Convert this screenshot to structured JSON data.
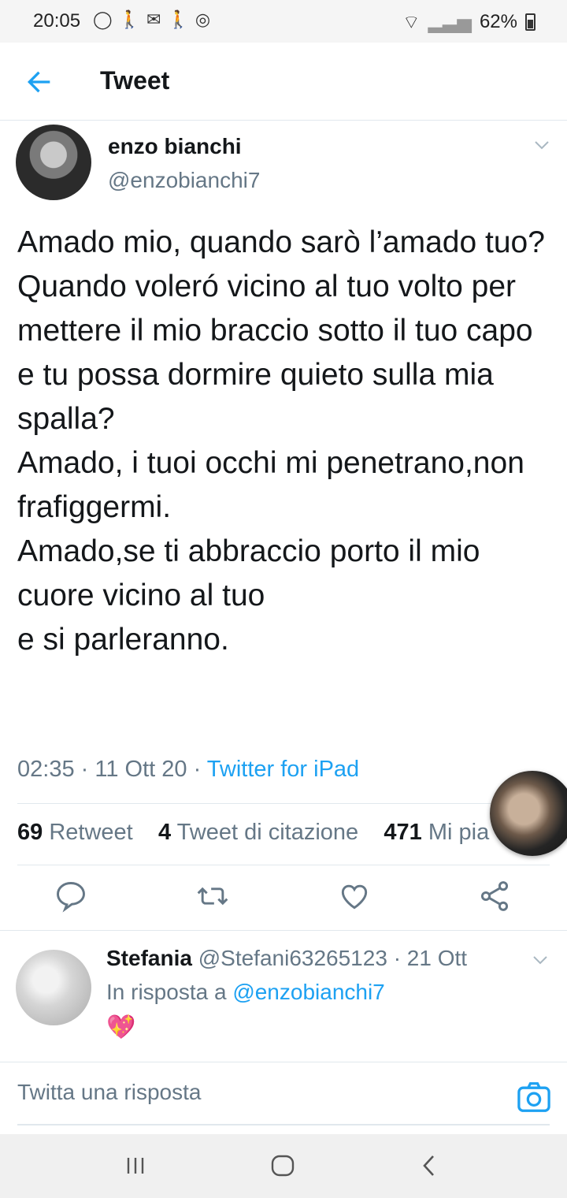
{
  "status_bar": {
    "time": "20:05",
    "battery": "62%"
  },
  "header": {
    "title": "Tweet"
  },
  "tweet": {
    "author_name": "enzo bianchi",
    "author_handle": "@enzobianchi7",
    "text": "Amado mio, quando sarò l’amado tuo?\nQuando voleró vicino al tuo volto per mettere il mio braccio sotto il tuo capo\ne tu possa dormire quieto sulla mia spalla?\nAmado, i tuoi occhi mi penetrano,non frafiggermi.\nAmado,se ti abbraccio porto il mio cuore vicino al tuo\ne si parleranno.",
    "time": "02:35",
    "date": "11 Ott 20",
    "source": "Twitter for iPad",
    "stats": {
      "retweets_count": "69",
      "retweets_label": "Retweet",
      "quotes_count": "4",
      "quotes_label": "Tweet di citazione",
      "likes_count": "471",
      "likes_label": "Mi pia"
    }
  },
  "reply": {
    "name": "Stefania",
    "handle": "@Stefani63265123",
    "date": "21 Ott",
    "in_reply_to_label": "In risposta a",
    "in_reply_to_handle": "@enzobianchi7",
    "emoji": "💖"
  },
  "composer": {
    "placeholder": "Twitta una risposta"
  },
  "colors": {
    "accent": "#1da1f2",
    "secondary_text": "#657786",
    "divider": "#e1e8ed"
  }
}
